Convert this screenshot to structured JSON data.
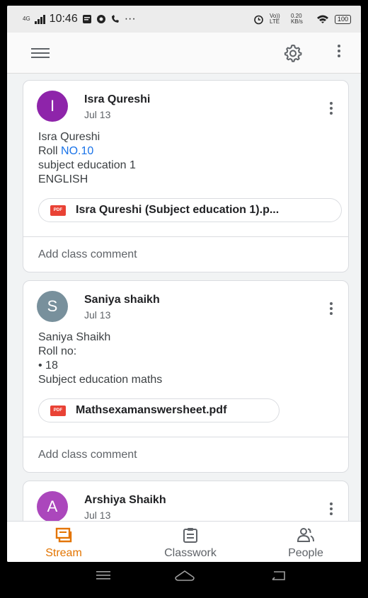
{
  "status_bar": {
    "network": "4G",
    "time": "10:46",
    "ellipsis": "···",
    "volte": "Vo)) LTE",
    "speed": "0.20 KB/s",
    "battery": "100"
  },
  "appbar": {
    "menu_icon": "menu-icon",
    "settings_icon": "gear-icon",
    "more_icon": "more-vert-icon"
  },
  "posts": [
    {
      "initial": "I",
      "avatar_color": "#8e24aa",
      "author": "Isra Qureshi",
      "date": "Jul 13",
      "lines": [
        "Isra Qureshi",
        "Roll ",
        "subject education 1",
        "ENGLISH"
      ],
      "roll_link": "NO.10",
      "attachment": "Isra  Qureshi (Subject education 1).p...",
      "comment": "Add class comment"
    },
    {
      "initial": "S",
      "avatar_color": "#78909c",
      "author": "Saniya shaikh",
      "date": "Jul 13",
      "lines": [
        "Saniya Shaikh",
        "Roll no:",
        "• 18",
        "Subject education maths"
      ],
      "attachment": "Mathsexamanswersheet.pdf",
      "comment": "Add class comment"
    },
    {
      "initial": "A",
      "avatar_color": "#ab47bc",
      "author": "Arshiya Shaikh",
      "date": "Jul 13"
    }
  ],
  "pdf_badge": "PDF",
  "bottom_nav": [
    {
      "label": "Stream",
      "icon": "stream-icon",
      "active": true
    },
    {
      "label": "Classwork",
      "icon": "classwork-icon",
      "active": false
    },
    {
      "label": "People",
      "icon": "people-icon",
      "active": false
    }
  ],
  "colors": {
    "accent": "#e37400",
    "link": "#1a73e8",
    "pdf": "#e94235"
  }
}
